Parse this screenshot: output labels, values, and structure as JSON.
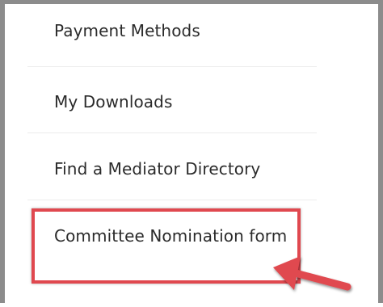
{
  "menu": {
    "items": [
      {
        "label": "Payment Methods"
      },
      {
        "label": "My Downloads"
      },
      {
        "label": "Find a Mediator Directory"
      },
      {
        "label": "Committee Nomination form"
      }
    ]
  },
  "annotation": {
    "highlight_color": "#e0484f",
    "arrow_icon": "red-arrow-icon"
  }
}
